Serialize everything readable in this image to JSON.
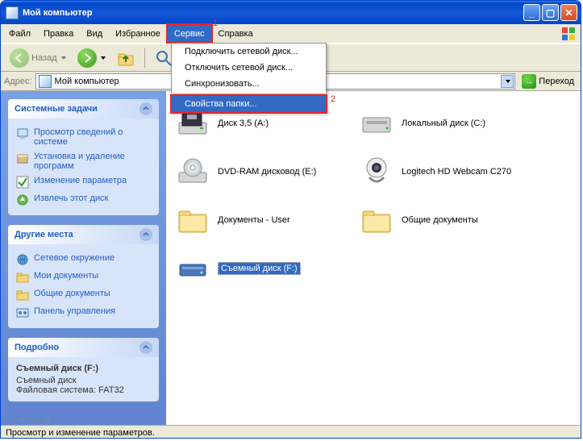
{
  "window": {
    "title": "Мой компьютер"
  },
  "menu": {
    "file": "Файл",
    "edit": "Правка",
    "view": "Вид",
    "favorites": "Избранное",
    "tools": "Сервис",
    "help": "Справка"
  },
  "tools_menu": {
    "map_network": "Подключить сетевой диск...",
    "disconnect_network": "Отключить сетевой диск...",
    "synchronize": "Синхронизовать...",
    "folder_options": "Свойства папки..."
  },
  "annotations": {
    "one": "1",
    "two": "2"
  },
  "toolbar": {
    "back": "Назад"
  },
  "address": {
    "label": "Адрес:",
    "value": "Мой компьютер",
    "go": "Переход"
  },
  "sidebar": {
    "system_tasks": {
      "title": "Системные задачи",
      "view_info": "Просмотр сведений о системе",
      "add_remove": "Установка и удаление программ",
      "change_setting": "Изменение параметра",
      "eject": "Извлечь этот диск"
    },
    "other_places": {
      "title": "Другие места",
      "network": "Сетевое окружение",
      "my_docs": "Мои документы",
      "shared_docs": "Общие документы",
      "control_panel": "Панель управления"
    },
    "details": {
      "title": "Подробно",
      "item_name": "Съемный диск (F:)",
      "item_type": "Съемный диск",
      "filesystem": "Файловая система: FAT32"
    }
  },
  "items": {
    "floppy": "Диск 3,5 (A:)",
    "local_c": "Локальный диск (C:)",
    "dvd": "DVD-RAM дисковод (E:)",
    "webcam": "Logitech HD Webcam C270",
    "docs_user": "Документы - User",
    "shared_docs": "Общие документы",
    "removable_f": "Съемный диск (F:)"
  },
  "status": {
    "text": "Просмотр и изменение параметров."
  },
  "watermark": {
    "text_a": "s",
    "text_b": "ftikb",
    "text_c": "x"
  }
}
